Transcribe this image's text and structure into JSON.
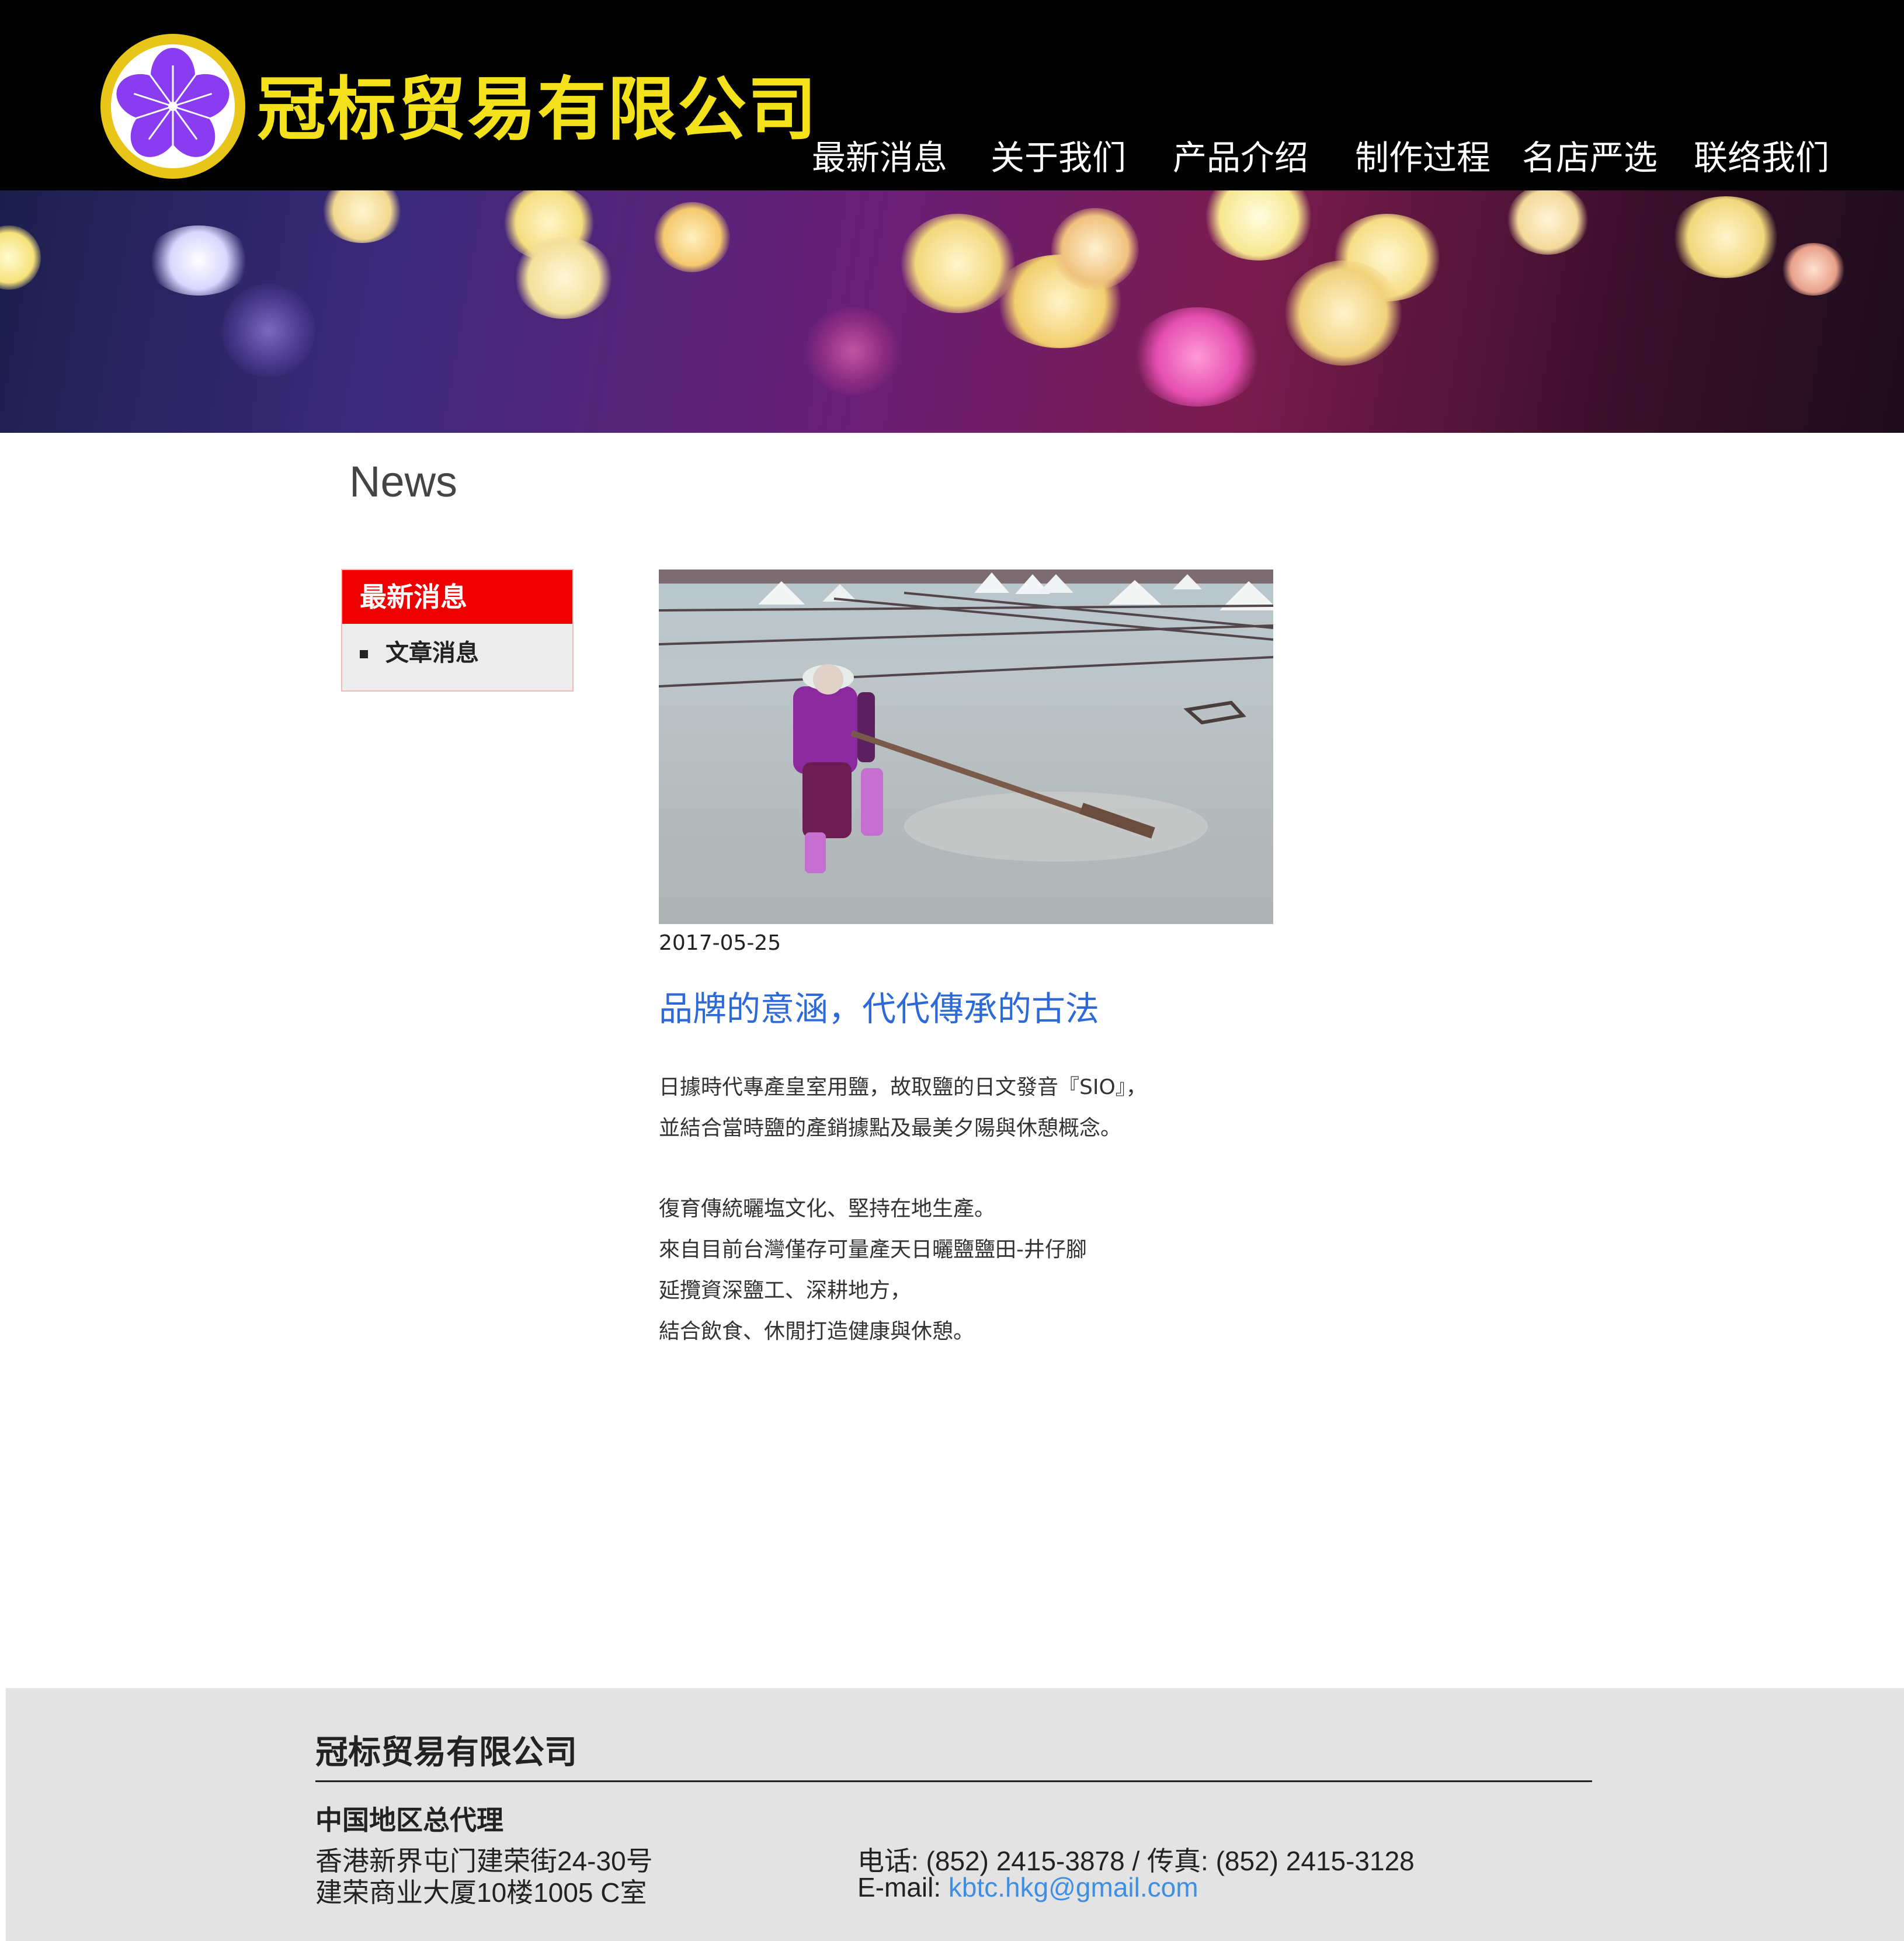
{
  "header": {
    "brand": "冠标贸易有限公司",
    "logo_icon": "purple-flower-icon",
    "colors": {
      "bg": "#000000",
      "brand": "#f3e21b",
      "logo_ring": "#e8c619",
      "flower": "#8a3cf0"
    }
  },
  "nav": {
    "items": [
      {
        "label": "最新消息"
      },
      {
        "label": "关于我们"
      },
      {
        "label": "产品介绍"
      },
      {
        "label": "制作过程"
      },
      {
        "label": "名店严选"
      },
      {
        "label": "联络我们"
      }
    ]
  },
  "page": {
    "heading": "News"
  },
  "sidebar": {
    "title": "最新消息",
    "items": [
      {
        "label": "文章消息"
      }
    ],
    "colors": {
      "head": "#ee0000"
    }
  },
  "article": {
    "image_desc_icon": "salt-field-photo",
    "date": "2017-05-25",
    "title": "品牌的意涵，代代傳承的古法",
    "paragraphs": [
      "日據時代專產皇室用鹽，故取鹽的日文發音『SIO』，",
      "並結合當時鹽的產銷據點及最美夕陽與休憩概念。",
      "復育傳統曬塩文化、堅持在地生產。",
      "來自目前台灣僅存可量產天日曬鹽鹽田-井仔腳",
      "延攬資深鹽工、深耕地方，",
      "結合飲食、休閒打造健康與休憩。"
    ]
  },
  "footer": {
    "company": "冠标贸易有限公司",
    "subtitle": "中国地区总代理",
    "address_line1": "香港新界屯门建荣街24-30号",
    "address_line2": "建荣商业大厦10楼1005 C室",
    "phone_line": "电话: (852) 2415-3878 / 传真: (852) 2415-3128",
    "email_label": "E-mail: ",
    "email": "kbtc.hkg@gmail.com"
  }
}
